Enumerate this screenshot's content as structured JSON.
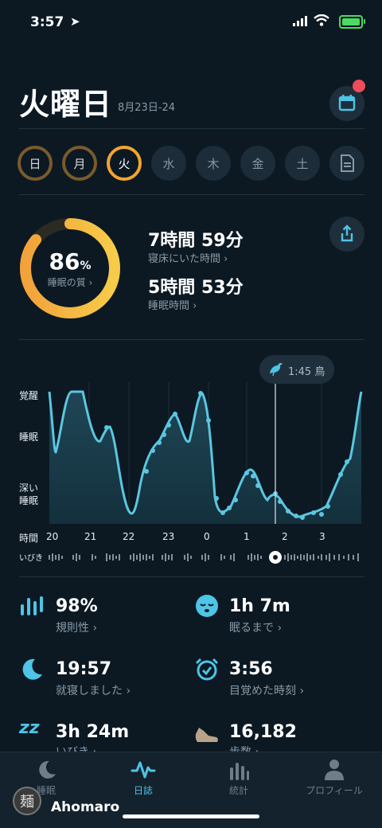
{
  "status_bar": {
    "time": "3:57"
  },
  "header": {
    "day_title": "火曜日",
    "date_range": "8月23日-24"
  },
  "week": {
    "days": [
      "日",
      "月",
      "火",
      "水",
      "木",
      "金",
      "土"
    ],
    "current_index": 2
  },
  "quality": {
    "value": "86",
    "unit": "%",
    "label": "睡眠の質 ›",
    "fraction": 0.86
  },
  "summary": {
    "in_bed_value": "7時間 59分",
    "in_bed_label": "寝床にいた時間 ›",
    "asleep_value": "5時間 53分",
    "asleep_label": "睡眠時間 ›"
  },
  "chart_data": {
    "type": "area",
    "y_labels": [
      "覚醒",
      "睡眠",
      "深い",
      "睡眠"
    ],
    "x_axis_label": "時間",
    "snore_label": "いびき",
    "x_ticks": [
      "20",
      "21",
      "22",
      "23",
      "0",
      "1",
      "2",
      "3"
    ],
    "marker": {
      "time": "1:45",
      "label": "鳥"
    }
  },
  "stats": [
    {
      "value": "98%",
      "label": "規則性 ›",
      "icon": "bars-icon"
    },
    {
      "value": "1h  7m",
      "label": "眠るまで ›",
      "icon": "sleepy-face-icon"
    },
    {
      "value": "19:57",
      "label": "就寝しました ›",
      "icon": "moon-icon"
    },
    {
      "value": "3:56",
      "label": "目覚めた時刻 ›",
      "icon": "alarm-icon"
    },
    {
      "value": "3h 24m",
      "label": "いびき ›",
      "icon": "zzz-icon"
    },
    {
      "value": "16,182",
      "label": "歩数 ›",
      "icon": "shoe-icon"
    }
  ],
  "tabs": [
    {
      "label": "睡眠",
      "active": false
    },
    {
      "label": "日誌",
      "active": true
    },
    {
      "label": "統計",
      "active": false
    },
    {
      "label": "プロフィール",
      "active": false
    }
  ],
  "watermark": {
    "name": "Ahomaro",
    "glyph": "麺"
  },
  "colors": {
    "accent": "#4ec4e6",
    "ring": "#f3a52d",
    "background": "#0c1923"
  }
}
